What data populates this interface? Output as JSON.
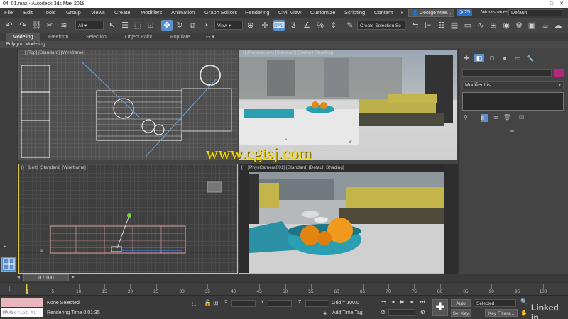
{
  "window": {
    "title": "04_01.max - Autodesk 3ds Max 2018"
  },
  "menu": {
    "items": [
      "File",
      "Edit",
      "Tools",
      "Group",
      "Views",
      "Create",
      "Modifiers",
      "Animation",
      "Graph Editors",
      "Rendering",
      "Civil View",
      "Customize",
      "Scripting",
      "Content"
    ],
    "user": "George Mae...",
    "badge": "25",
    "workspaces_label": "Workspaces:",
    "workspace": "Default"
  },
  "toolbar": {
    "filter_select": "All",
    "ref_coord_select": "View",
    "selection_set": "Create Selection Se"
  },
  "ribbon": {
    "tabs": [
      "Modeling",
      "Freeform",
      "Selection",
      "Object Paint",
      "Populate"
    ],
    "active_tab": "Modeling",
    "sub": "Polygon Modeling"
  },
  "viewports": {
    "top": "[+] [Top] [Standard] [Wireframe]",
    "perspective": "[+] [Perspective] [Standard] [Default Shading]",
    "left": "[+] [Left] [Standard] [Wireframe]",
    "camera": "[+] [PhysCamera001] [Standard] [Default Shading]"
  },
  "command_panel": {
    "modifier_list": "Modifier List",
    "object_color": "#b4297e"
  },
  "timeline": {
    "slider": "0 / 100",
    "ticks": [
      "0",
      "5",
      "10",
      "15",
      "20",
      "25",
      "30",
      "35",
      "40",
      "45",
      "50",
      "55",
      "60",
      "65",
      "70",
      "75",
      "80",
      "85",
      "90",
      "95",
      "100"
    ]
  },
  "status": {
    "selection": "None Selected",
    "rendering_time": "Rendering Time  0:01:35",
    "x_label": "X:",
    "y_label": "Y:",
    "z_label": "Z:",
    "grid": "Grid = 100.0",
    "add_time_tag": "Add Time Tag",
    "auto_key": "Auto Key",
    "set_key": "Set Key",
    "key_mode": "Selected",
    "key_filters": "Key Filters...",
    "maxscript": "MAXScript Mi"
  },
  "watermark": "www.cgtsj.com",
  "branding": "Linked in"
}
